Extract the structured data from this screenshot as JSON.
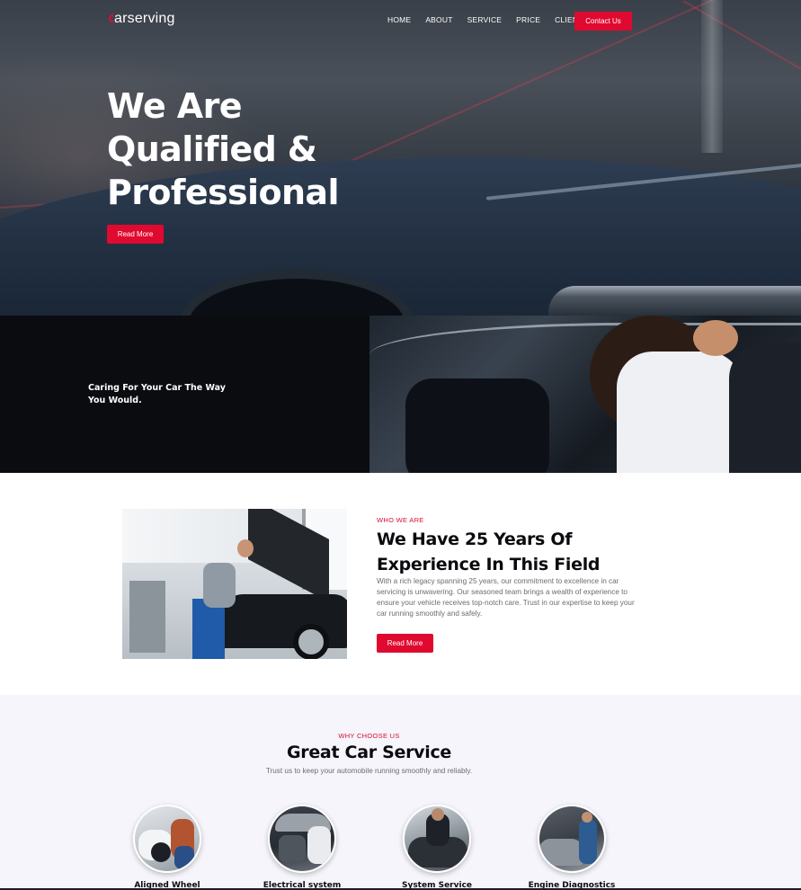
{
  "nav": {
    "logo_text": "arserving",
    "links": [
      "HOME",
      "ABOUT",
      "SERVICE",
      "PRICE",
      "CLIENT"
    ],
    "contact_label": "Contact Us"
  },
  "hero": {
    "title_line1": "We Are",
    "title_line2": "Qualified &",
    "title_line3": "Professional",
    "button_label": "Read More"
  },
  "band": {
    "text": "Caring For Your Car The Way You Would."
  },
  "about": {
    "tag": "WHO WE ARE",
    "title": "We Have 25 Years Of Experience In This Field",
    "body": "With a rich legacy spanning 25 years, our commitment to excellence in car servicing is unwavering. Our seasoned team brings a wealth of experience to ensure your vehicle receives top-notch care. Trust in our expertise to keep your car running smoothly and safely.",
    "button_label": "Read More"
  },
  "services": {
    "tag": "WHY CHOOSE US",
    "title": "Great Car Service",
    "subtitle": "Trust us to keep your automobile running smoothly and reliably.",
    "items": [
      {
        "label": "Aligned Wheel"
      },
      {
        "label": "Electrical system"
      },
      {
        "label": "System Service"
      },
      {
        "label": "Engine Diagnostics"
      }
    ]
  },
  "colors": {
    "accent": "#e0092f",
    "dark": "#0b0c10",
    "light_bg": "#f5f5fb"
  }
}
